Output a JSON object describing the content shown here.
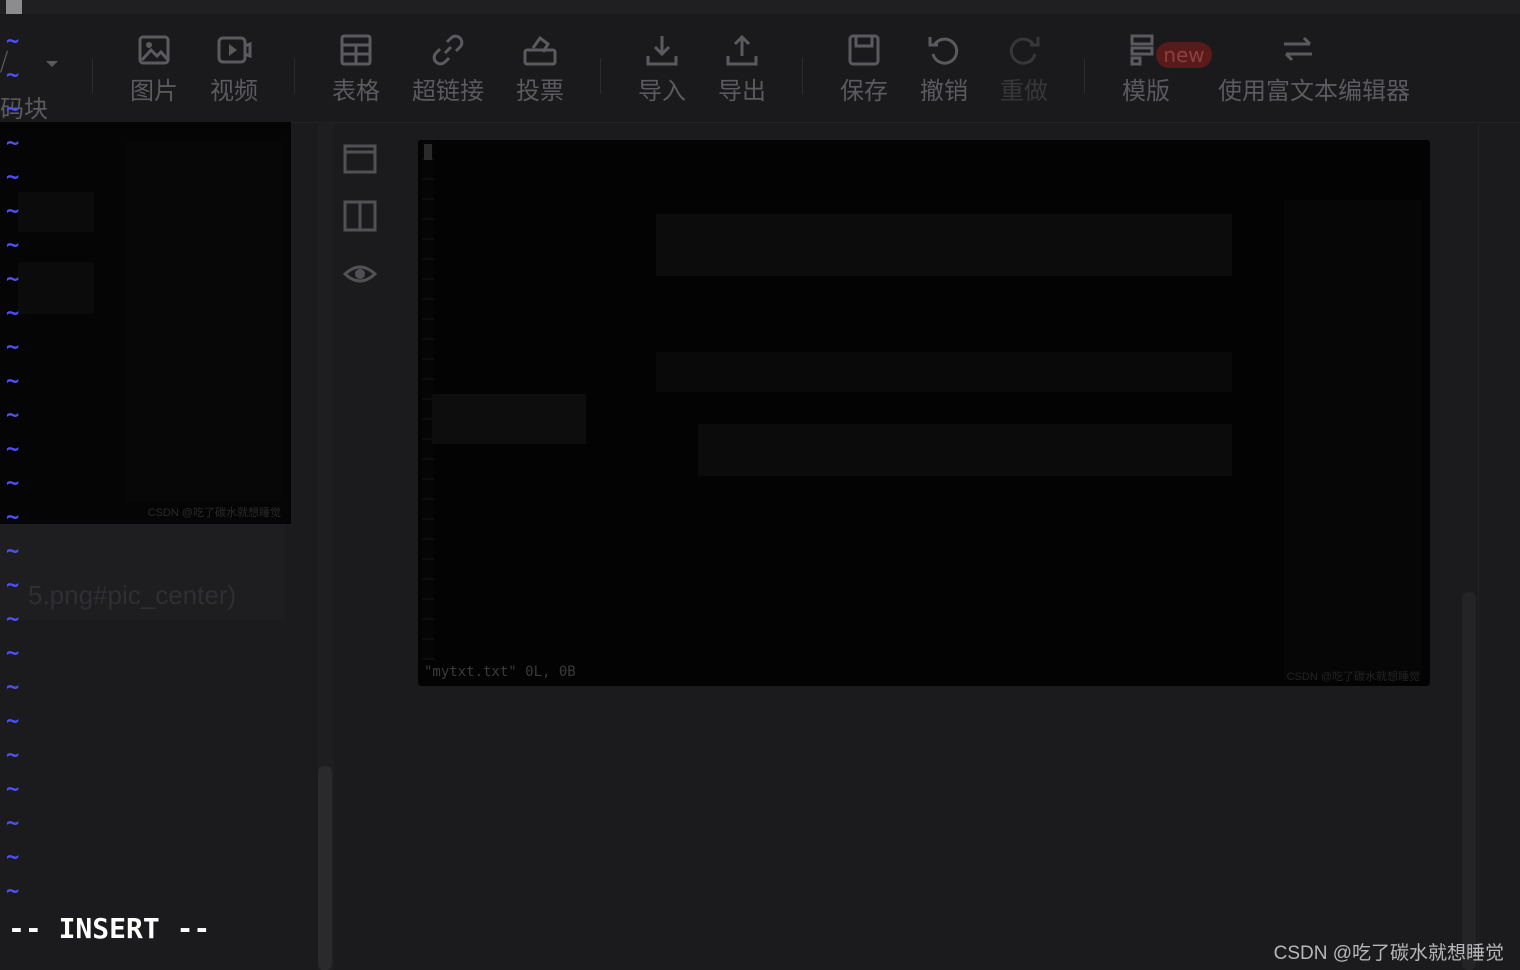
{
  "toolbar": {
    "partial_top": "⧸",
    "partial_label": "码块",
    "tools": [
      {
        "label": "图片",
        "icon": "image-icon"
      },
      {
        "label": "视频",
        "icon": "video-icon"
      },
      {
        "label": "表格",
        "icon": "table-icon"
      },
      {
        "label": "超链接",
        "icon": "link-icon"
      },
      {
        "label": "投票",
        "icon": "vote-icon"
      },
      {
        "label": "导入",
        "icon": "import-icon"
      },
      {
        "label": "导出",
        "icon": "export-icon"
      },
      {
        "label": "保存",
        "icon": "save-icon"
      },
      {
        "label": "撤销",
        "icon": "undo-icon"
      },
      {
        "label": "重做",
        "icon": "redo-icon",
        "disabled": true
      },
      {
        "label": "模版",
        "icon": "template-icon"
      },
      {
        "label": "使用富文本编辑器",
        "icon": "switch-editor-icon"
      }
    ],
    "new_badge": "new"
  },
  "editor": {
    "image_url_fragment": "5.png#pic_center)"
  },
  "screenshot": {
    "status_line": "\"mytxt.txt\" 0L, 0B",
    "watermark": "CSDN @吃了碳水就想睡觉"
  },
  "left_screenshot": {
    "watermark": "CSDN @吃了碳水就想睡觉"
  },
  "vim": {
    "tilde": "~",
    "mode": "-- INSERT --"
  },
  "watermark": "CSDN @吃了碳水就想睡觉",
  "colors": {
    "tilde": "#4f4fff",
    "insert": "#ffffff",
    "background": "#1b1b1d"
  }
}
